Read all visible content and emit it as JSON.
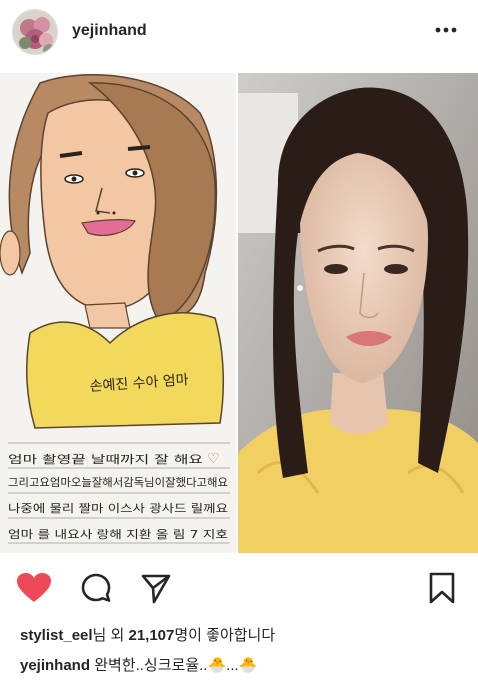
{
  "post": {
    "username": "yejinhand",
    "more_icon": "more-dots-icon"
  },
  "drawing": {
    "portrait_label": "손예진 수아 엄마",
    "letter_lines": [
      "엄마 촬영끝 날때까지  잘 해요",
      "그리고요엄마오늘잘해서감독님이잘했다고해요",
      "나중에 물리 짤마 이스사 광사드 릴께요",
      "엄마 를 내요사 랑해        지환 올 림 7 지호"
    ]
  },
  "actions": {
    "like_icon": "heart-filled-icon",
    "comment_icon": "comment-icon",
    "share_icon": "send-icon",
    "save_icon": "bookmark-icon",
    "like_color": "#ed4956"
  },
  "likes": {
    "user": "stylist_eel",
    "middle": "님 외 ",
    "count": "21,107",
    "suffix": "명이 좋아합니다"
  },
  "caption": {
    "user": "yejinhand",
    "text": "완벽한..싱크로율..",
    "emoji_1": "🐣",
    "sep": "...",
    "emoji_2": "🐣"
  }
}
